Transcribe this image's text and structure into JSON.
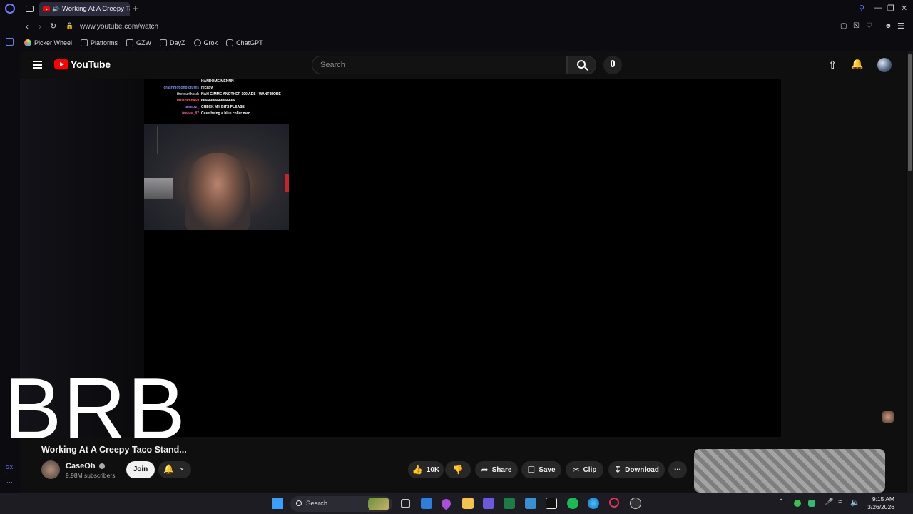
{
  "browser": {
    "tab_title": "Working At A Creepy Ta",
    "url": "www.youtube.com/watch",
    "bookmarks": [
      {
        "label": "Picker Wheel"
      },
      {
        "label": "Platforms"
      },
      {
        "label": "GZW"
      },
      {
        "label": "DayZ"
      },
      {
        "label": "Grok"
      },
      {
        "label": "ChatGPT"
      }
    ],
    "sidebar_gx_label": "GX"
  },
  "youtube": {
    "logo_text": "YouTube",
    "search_placeholder": "Search",
    "video": {
      "chat": [
        {
          "user": "",
          "msg": "HANDOME MENNN",
          "color": "#ffffff"
        },
        {
          "user": "crashmotionpictures",
          "msg": "recapv",
          "color": "#7a8fff"
        },
        {
          "user": "thefourthoub",
          "msg": "NAH GIMME ANOTHER 100 ADS I WANT MORE",
          "color": "#c8c8c8"
        },
        {
          "user": "urbadimba69",
          "msg": "66666666666666666",
          "color": "#ff5a5a"
        },
        {
          "user": "tanerzz_",
          "msg": "CHECK MY BITS PLEASE!",
          "color": "#b070ff"
        },
        {
          "user": "teeeee_87",
          "msg": "Case being a blue collar man",
          "color": "#ff4fa0"
        }
      ],
      "overlay_text": "BRB"
    },
    "title": "Working At A Creepy Taco Stand...",
    "channel": {
      "name": "CaseOh",
      "subscribers": "9.98M subscribers",
      "join_label": "Join"
    },
    "actions": {
      "likes": "10K",
      "share": "Share",
      "save": "Save",
      "clip": "Clip",
      "download": "Download"
    }
  },
  "taskbar": {
    "search_label": "Search",
    "time": "9:15 AM",
    "date": "3/26/2026"
  },
  "colors": {
    "youtube_red": "#ff0000",
    "background": "#0f0f0f",
    "pill_bg": "#272727"
  }
}
